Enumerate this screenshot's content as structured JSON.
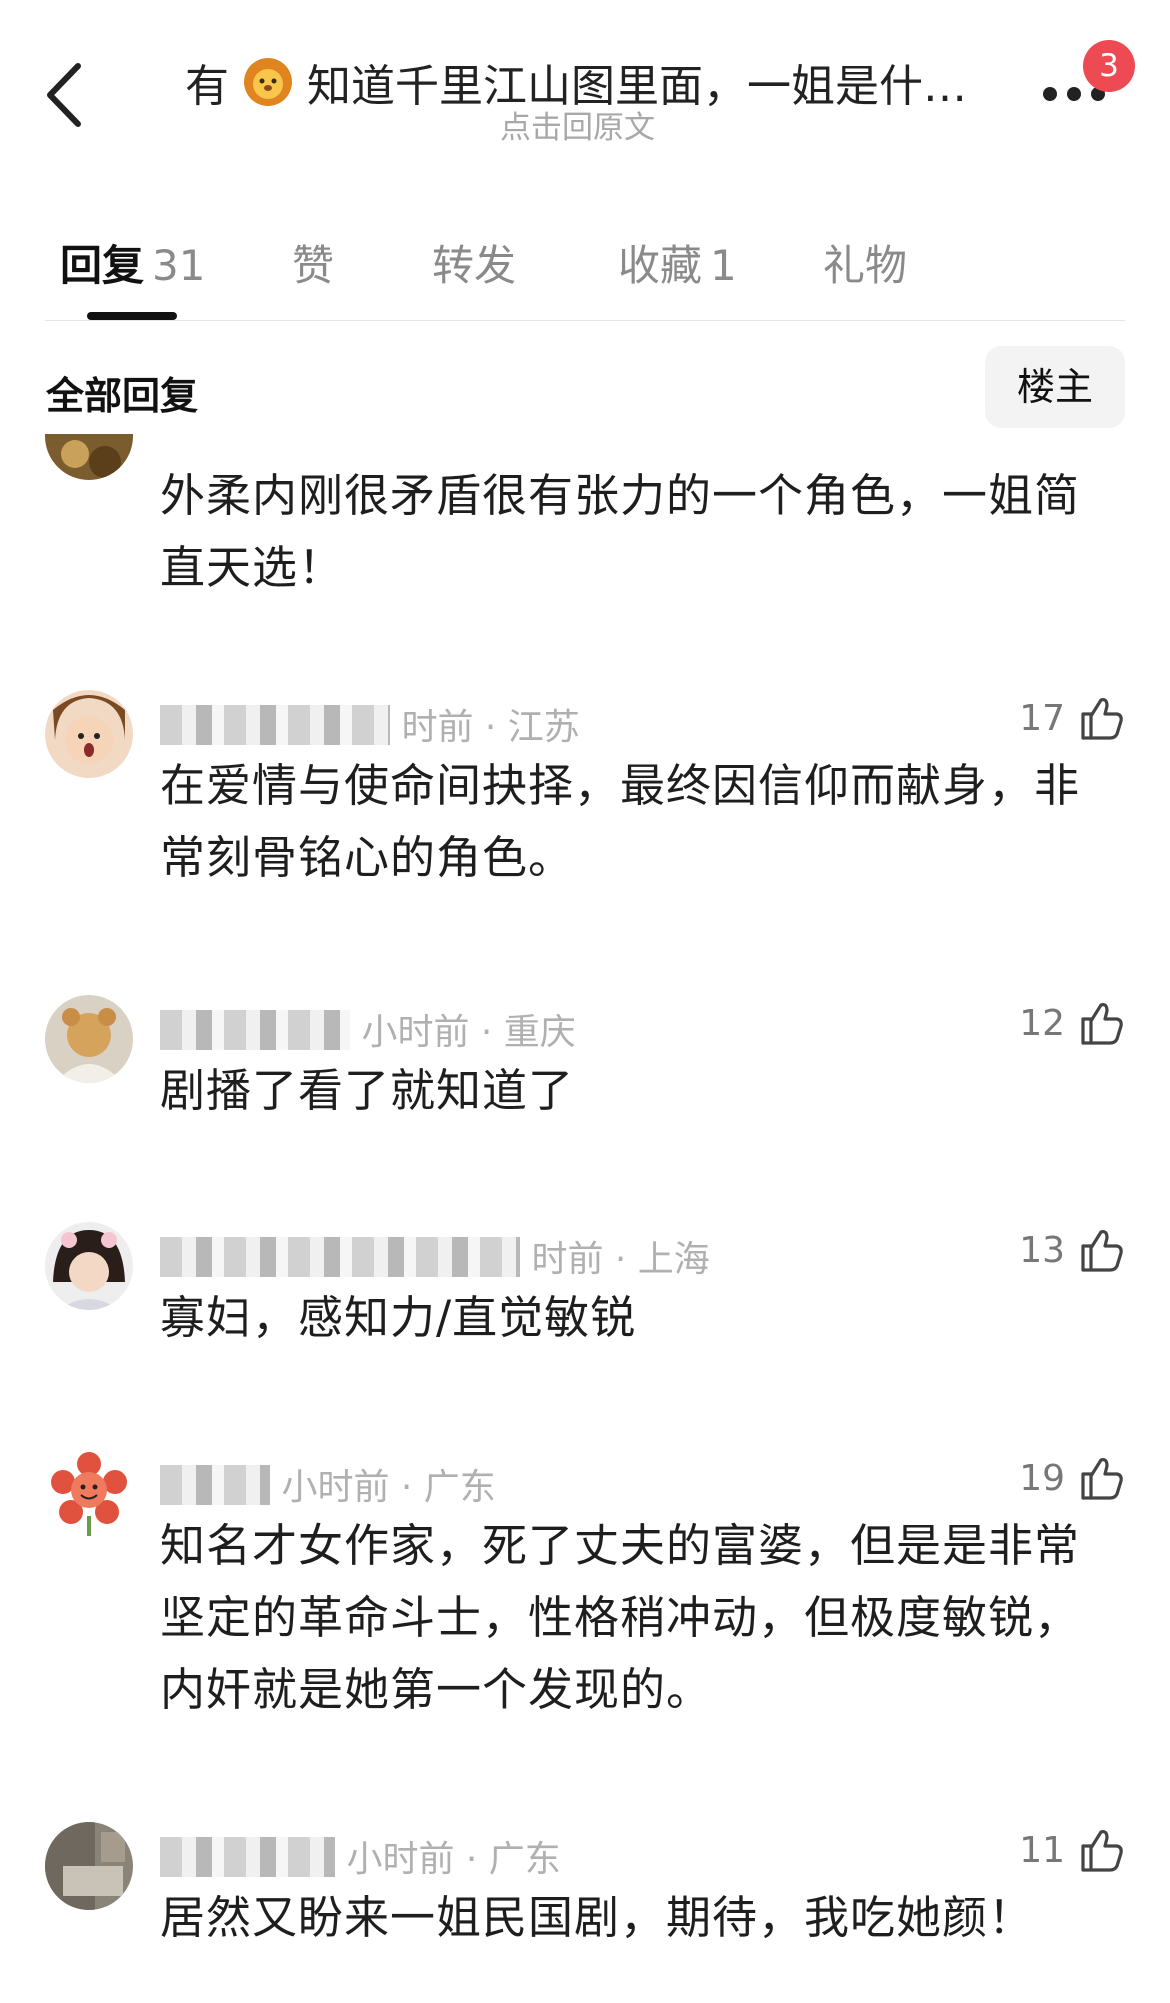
{
  "header": {
    "title_prefix": "有",
    "title_suffix": "知道千里江山图里面，一姐是什…",
    "subtitle": "点击回原文",
    "badge_count": "3"
  },
  "tabs": [
    {
      "label": "回复",
      "count": "31"
    },
    {
      "label": "赞",
      "count": ""
    },
    {
      "label": "转发",
      "count": ""
    },
    {
      "label": "收藏",
      "count": "1"
    },
    {
      "label": "礼物",
      "count": ""
    }
  ],
  "section": {
    "title": "全部回复",
    "owner_label": "楼主"
  },
  "comments": [
    {
      "text": "外柔内刚很矛盾很有张力的一个角色，一姐简直天选！"
    },
    {
      "meta": "时前 · 江苏",
      "likes": "17",
      "text": "在爱情与使命间抉择，最终因信仰而献身，非常刻骨铭心的角色。"
    },
    {
      "meta": "小时前 · 重庆",
      "likes": "12",
      "text": "剧播了看了就知道了"
    },
    {
      "meta": "时前 · 上海",
      "likes": "13",
      "text": "寡妇，感知力/直觉敏锐"
    },
    {
      "meta": "小时前 · 广东",
      "likes": "19",
      "text": "知名才女作家，死了丈夫的富婆，但是是非常坚定的革命斗士，性格稍冲动，但极度敏锐，内奸就是她第一个发现的。"
    },
    {
      "meta": "小时前 · 广东",
      "likes": "11",
      "text": "居然又盼来一姐民国剧，期待，我吃她颜！"
    }
  ],
  "colors": {
    "badge": "#ee4a53",
    "text": "#1e1e1e",
    "muted": "#b0b0b0"
  }
}
